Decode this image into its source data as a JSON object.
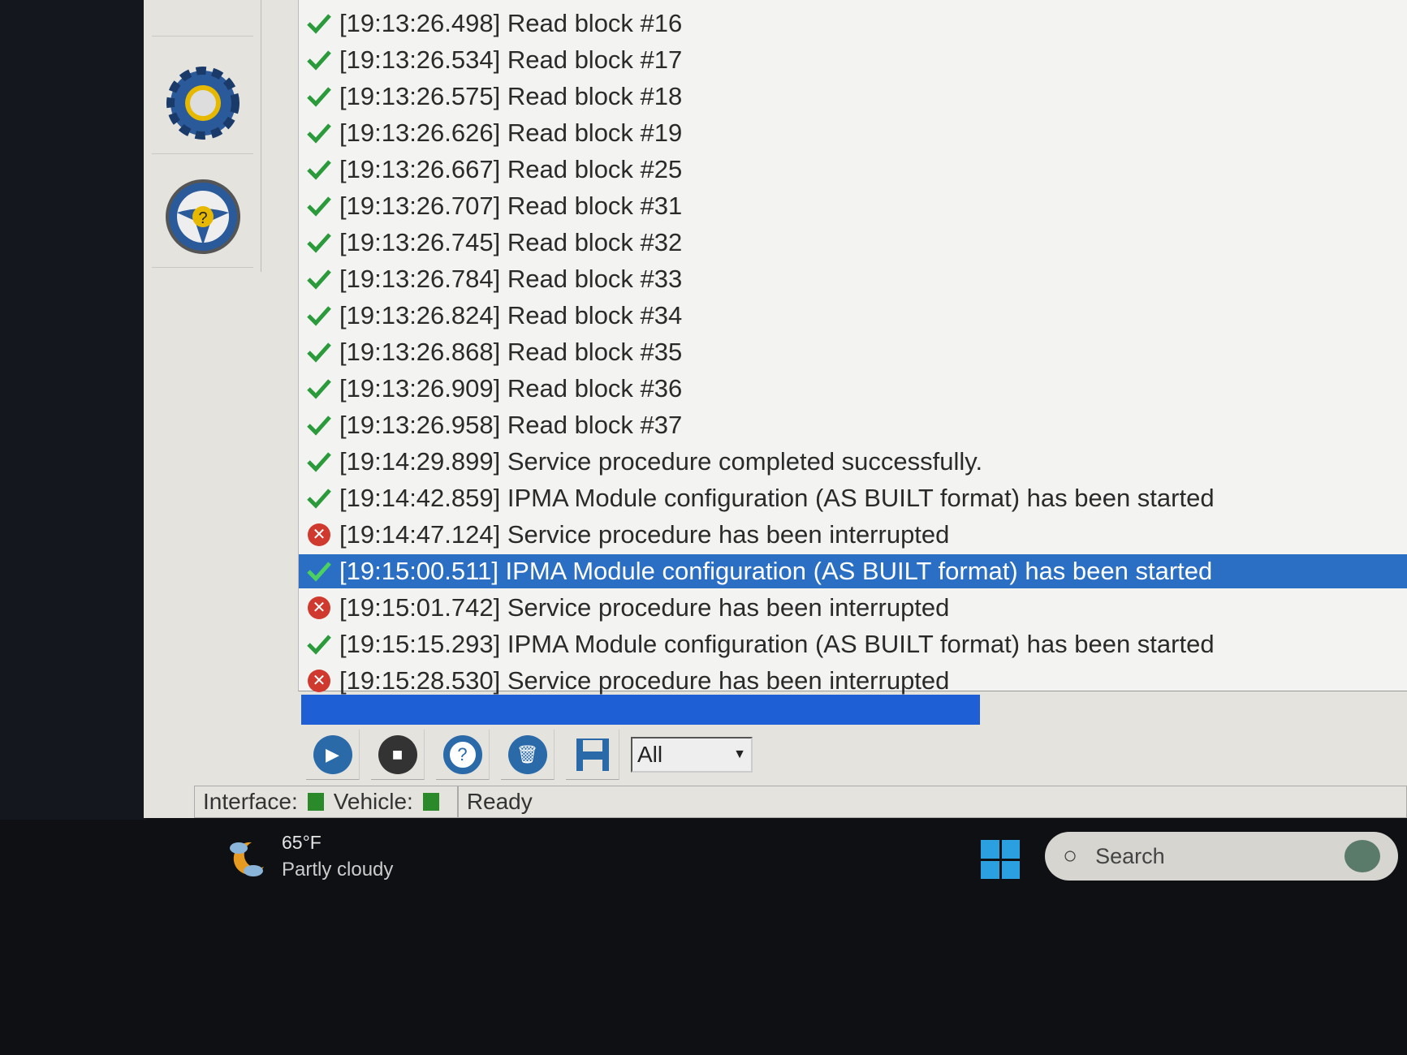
{
  "log": {
    "entries": [
      {
        "status": "ok",
        "text": "[19:13:26.498] Read block #16"
      },
      {
        "status": "ok",
        "text": "[19:13:26.534] Read block #17"
      },
      {
        "status": "ok",
        "text": "[19:13:26.575] Read block #18"
      },
      {
        "status": "ok",
        "text": "[19:13:26.626] Read block #19"
      },
      {
        "status": "ok",
        "text": "[19:13:26.667] Read block #25"
      },
      {
        "status": "ok",
        "text": "[19:13:26.707] Read block #31"
      },
      {
        "status": "ok",
        "text": "[19:13:26.745] Read block #32"
      },
      {
        "status": "ok",
        "text": "[19:13:26.784] Read block #33"
      },
      {
        "status": "ok",
        "text": "[19:13:26.824] Read block #34"
      },
      {
        "status": "ok",
        "text": "[19:13:26.868] Read block #35"
      },
      {
        "status": "ok",
        "text": "[19:13:26.909] Read block #36"
      },
      {
        "status": "ok",
        "text": "[19:13:26.958] Read block #37"
      },
      {
        "status": "ok",
        "text": "[19:14:29.899] Service procedure completed successfully."
      },
      {
        "status": "ok",
        "text": "[19:14:42.859] IPMA Module configuration (AS BUILT format) has been started"
      },
      {
        "status": "error",
        "text": "[19:14:47.124] Service procedure has been interrupted"
      },
      {
        "status": "ok",
        "text": "[19:15:00.511] IPMA Module configuration (AS BUILT format) has been started",
        "selected": true
      },
      {
        "status": "error",
        "text": "[19:15:01.742] Service procedure has been interrupted"
      },
      {
        "status": "ok",
        "text": "[19:15:15.293] IPMA Module configuration (AS BUILT format) has been started"
      },
      {
        "status": "error",
        "text": "[19:15:28.530] Service procedure has been interrupted"
      }
    ]
  },
  "progress": {
    "percent": 55
  },
  "toolbar": {
    "filter_value": "All"
  },
  "status": {
    "interface_label": "Interface:",
    "vehicle_label": "Vehicle:",
    "state": "Ready",
    "indicator_color": "#2a8a2a"
  },
  "taskbar": {
    "temperature": "65°F",
    "condition": "Partly cloudy",
    "search_placeholder": "Search"
  },
  "colors": {
    "accent": "#2a6fc4",
    "ok": "#2a9a3a",
    "error": "#d03a2e"
  }
}
